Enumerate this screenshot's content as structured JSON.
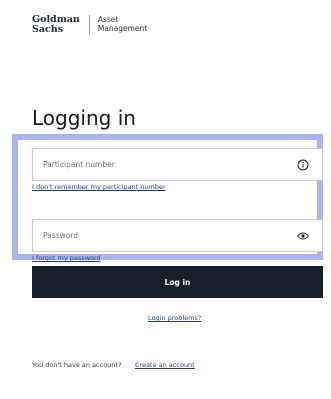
{
  "brand": {
    "primary_line1": "Goldman",
    "primary_line2": "Sachs",
    "secondary_line1": "Asset",
    "secondary_line2": "Management"
  },
  "page": {
    "title": "Logging in"
  },
  "participant": {
    "placeholder": "Participant number",
    "info_icon": "info-circle",
    "forgot_link": "I don't remember my participant number"
  },
  "password": {
    "placeholder": "Password",
    "toggle_icon": "eye",
    "forgot_link": "I forgot my password"
  },
  "actions": {
    "login_label": "Log in",
    "problems_link": "Login problems?"
  },
  "footer": {
    "no_account_text": "You don't have an account?",
    "create_link": "Create an account"
  },
  "colors": {
    "button_bg": "#15202b",
    "highlight_border": "#aab4ee",
    "link": "#1f3f8f"
  }
}
